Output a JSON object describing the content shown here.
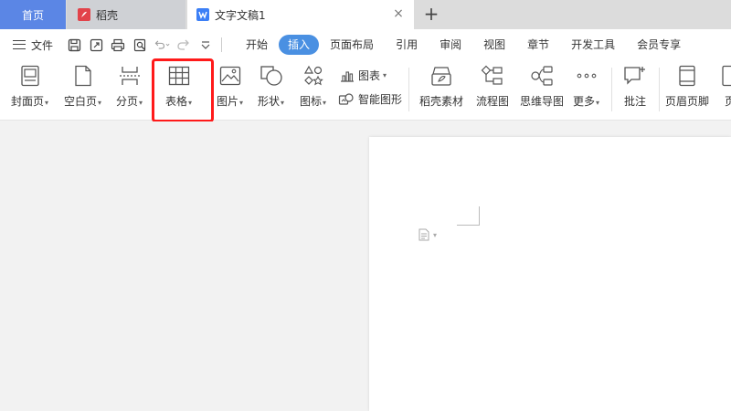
{
  "tabs": {
    "home": "首页",
    "daoke": "稻壳",
    "document": "文字文稿1",
    "add": "+",
    "close": "×"
  },
  "menubar": {
    "file": "文件",
    "items": [
      "开始",
      "插入",
      "页面布局",
      "引用",
      "审阅",
      "视图",
      "章节",
      "开发工具",
      "会员专享"
    ],
    "active": "插入"
  },
  "ribbon": {
    "cover_page": "封面页",
    "blank_page": "空白页",
    "page_break": "分页",
    "table": "表格",
    "picture": "图片",
    "shape": "形状",
    "icon": "图标",
    "chart": "图表",
    "smart_art": "智能图形",
    "daoke_material": "稻壳素材",
    "flowchart": "流程图",
    "mindmap": "思维导图",
    "more": "更多",
    "comment": "批注",
    "header_footer": "页眉页脚",
    "page_number_partial": "页"
  },
  "colors": {
    "accent": "#4a90e2",
    "home_tab": "#5b86e5",
    "highlight": "#ff1a1a"
  }
}
